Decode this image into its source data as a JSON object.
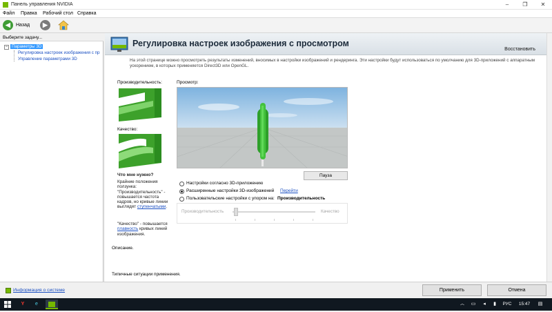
{
  "window": {
    "title": "Панель управления NVIDIA",
    "minimize": "–",
    "maximize": "❐",
    "close": "✕"
  },
  "menu": [
    "Файл",
    "Правка",
    "Рабочий стол",
    "Справка"
  ],
  "toolbar": {
    "back_label": "Назад"
  },
  "left_panel": {
    "header": "Выберите задачу...",
    "tree": {
      "root": "Параметры 3D",
      "children": [
        "Регулировка настроек изображения с пр",
        "Управление параметрами 3D"
      ]
    },
    "system_info_link": "Информация о системе"
  },
  "page": {
    "title": "Регулировка настроек изображения с просмотром",
    "restore_label": "Восстановить",
    "description": "На этой странице можно просмотреть результаты изменений, вносимых в настройки изображений и рендеринга. Эти настройки будут использоваться по умолчанию для 3D-приложений с аппаратным ускорением, в которых применяется Direct3D или OpenGL.",
    "performance_label": "Производительность:",
    "quality_label": "Качество:",
    "preview_label": "Просмотр:",
    "pause_button": "Пауза",
    "help": {
      "title": "Что мне нужно?",
      "text1": "Крайние положения ползунка: \"Производительность\" - повышается частота кадров, но кривые линии выглядят",
      "link1": "ступенчатыми",
      "text2": "\"Качество\" - повышается",
      "link2": "плавность",
      "text3": "кривых линий изображения."
    },
    "options": [
      {
        "label": "Настройки согласно 3D-приложению",
        "selected": false
      },
      {
        "label": "Расширенные настройки 3D-изображений",
        "selected": true,
        "link": "Перейти"
      },
      {
        "label": "Пользовательские настройки с упором на:",
        "selected": false,
        "emphasis": "Производительность"
      }
    ],
    "slider": {
      "left_label": "Производительность",
      "right_label": "Качество",
      "value": 0
    },
    "description_section_label": "Описание.",
    "typical_usage_label": "Типичные ситуации применения."
  },
  "buttons": {
    "apply": "Применить",
    "cancel": "Отмена"
  },
  "taskbar": {
    "language": "РУС",
    "time": "15:47"
  },
  "colors": {
    "nvidia_green": "#76b900",
    "link_blue": "#1a4fc2",
    "tree_selected": "#3399ff"
  }
}
